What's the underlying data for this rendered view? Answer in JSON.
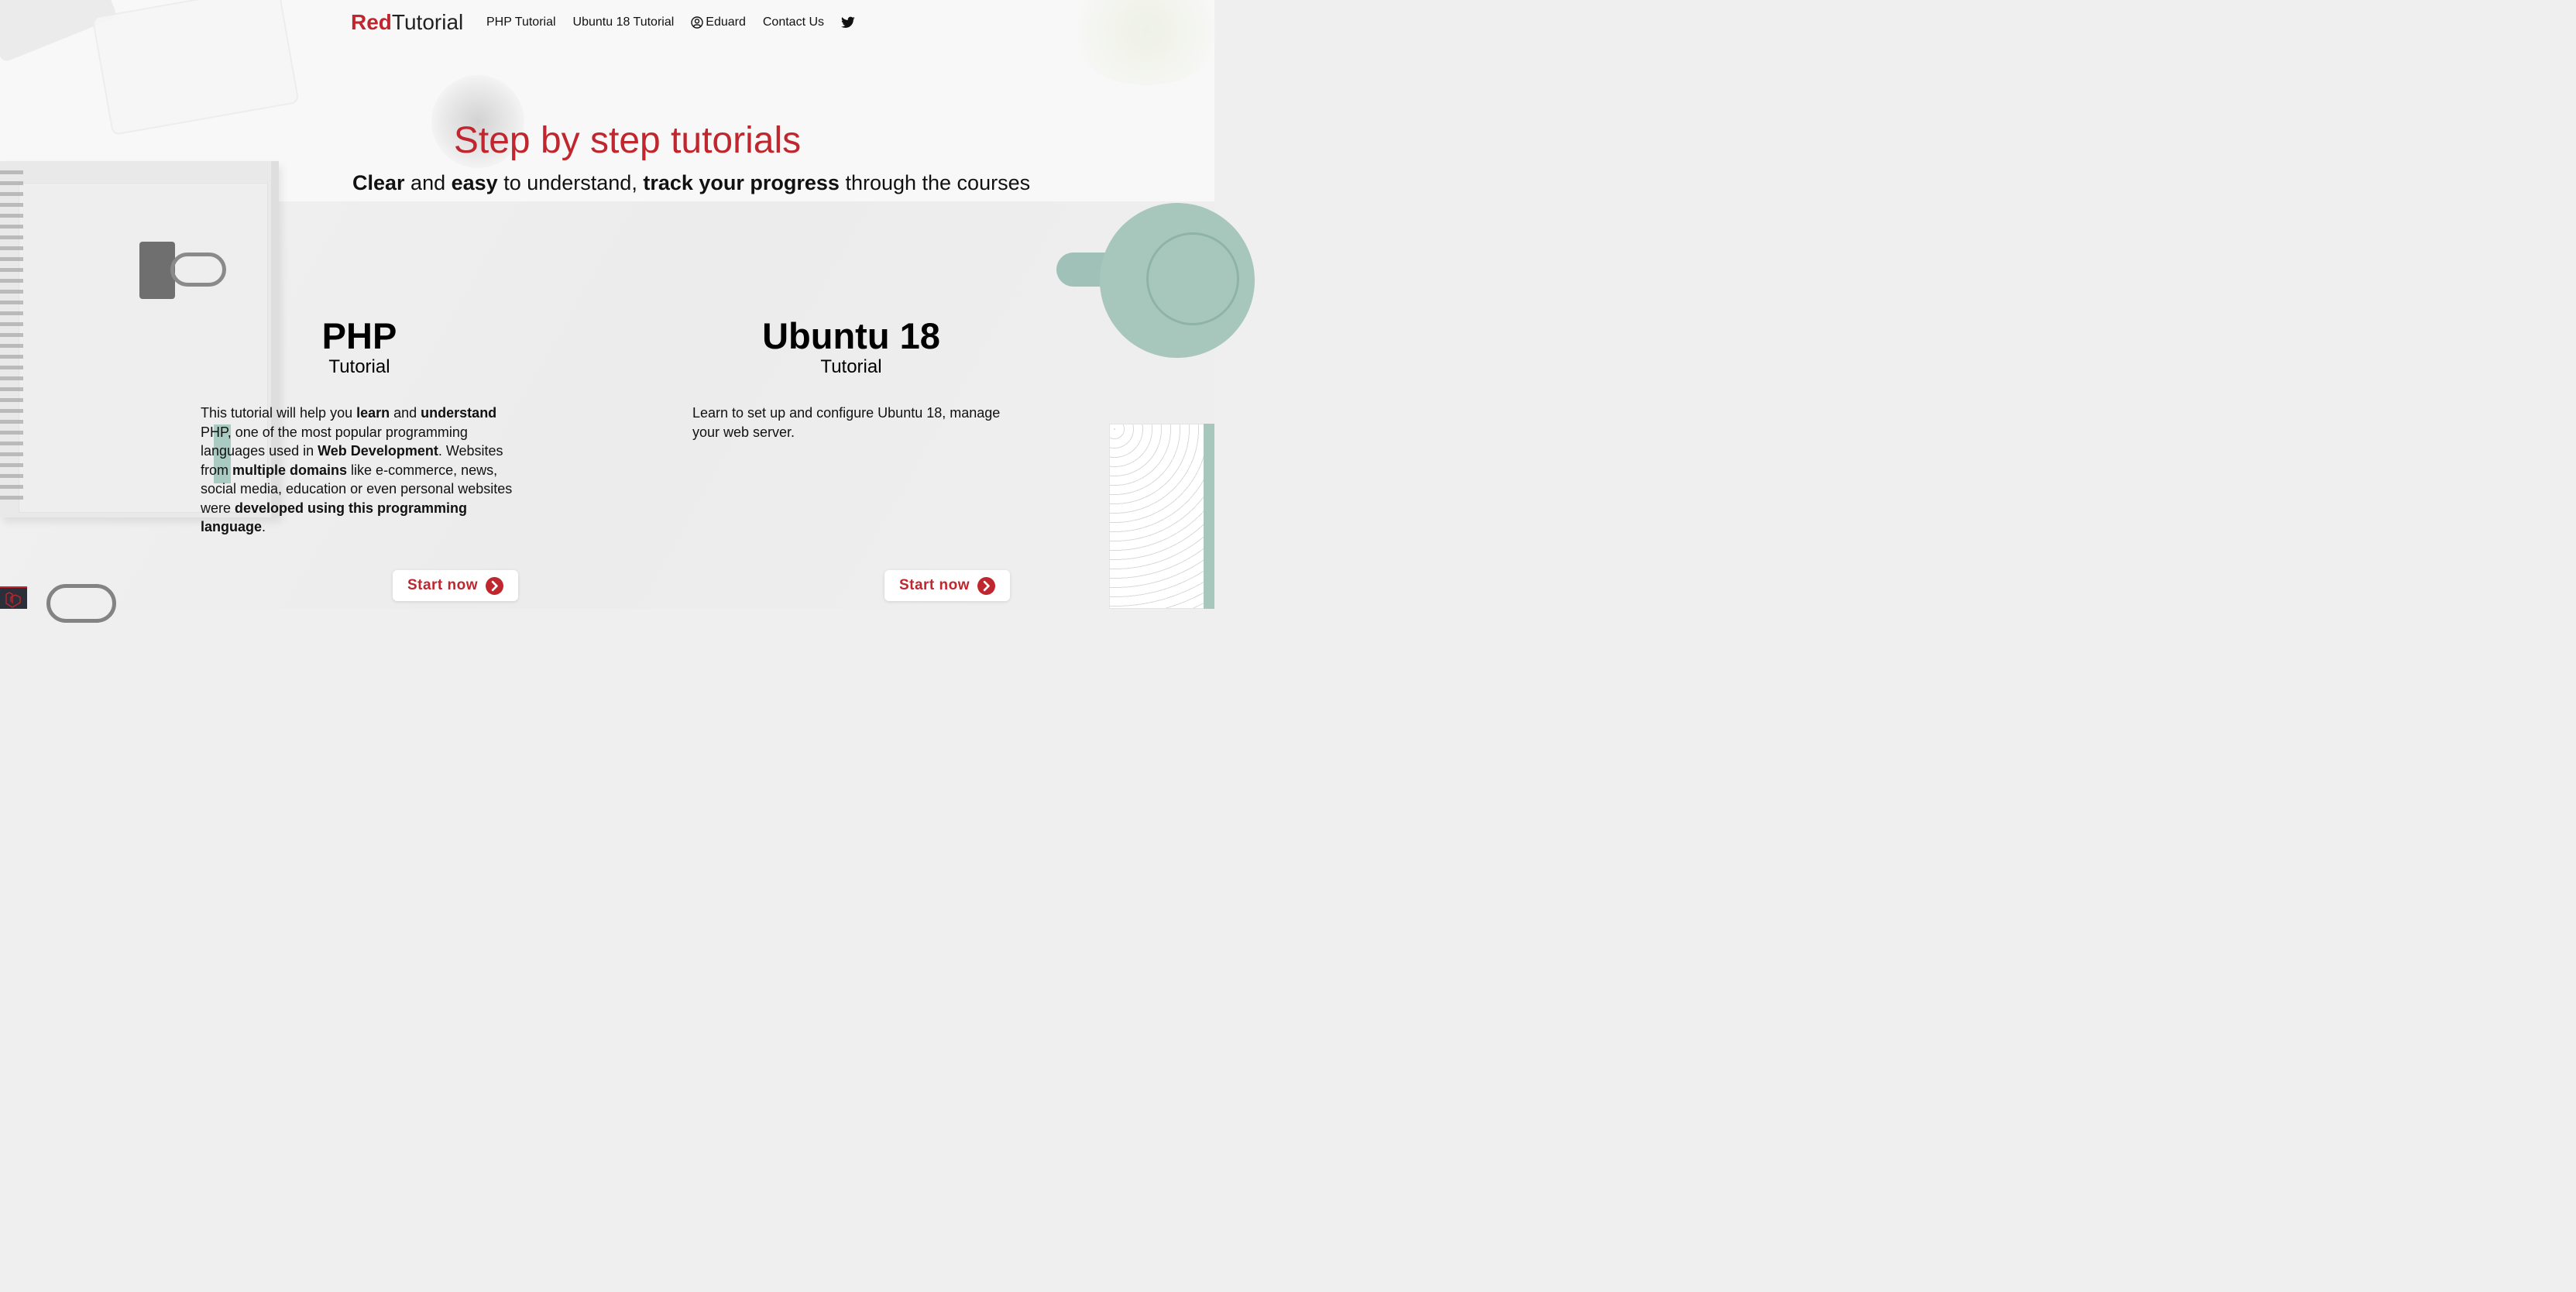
{
  "brand": {
    "part1": "Red",
    "part2": "Tutorial"
  },
  "nav": {
    "links": [
      "PHP Tutorial",
      "Ubuntu 18 Tutorial",
      "Eduard",
      "Contact Us"
    ],
    "user_icon": "user-circle-icon",
    "social_icon": "twitter-icon"
  },
  "hero": {
    "title": "Step by step tutorials",
    "subtitle": {
      "w1": "Clear",
      "t1": " and ",
      "w2": "easy",
      "t2": " to understand, ",
      "w3": "track your progress",
      "t3": " through the courses"
    }
  },
  "cards": [
    {
      "title": "PHP",
      "subtitle": "Tutorial",
      "desc": {
        "t1": "This tutorial will help you ",
        "b1": "learn",
        "t2": " and ",
        "b2": "understand",
        "t3": " PHP, one of the most popular programming languages used in ",
        "b3": "Web Development",
        "t4": ". Websites from ",
        "b4": "multiple domains",
        "t5": " like e-commerce, news, social media, education or even personal websites were ",
        "b5": "developed using this programming language",
        "t6": "."
      },
      "button": "Start now"
    },
    {
      "title": "Ubuntu 18",
      "subtitle": "Tutorial",
      "desc": {
        "t1": "Learn to set up and configure Ubuntu 18, manage your web server."
      },
      "button": "Start now"
    }
  ],
  "colors": {
    "accent": "#c0262d",
    "text": "#111111",
    "teal": "#a7c7bd"
  }
}
